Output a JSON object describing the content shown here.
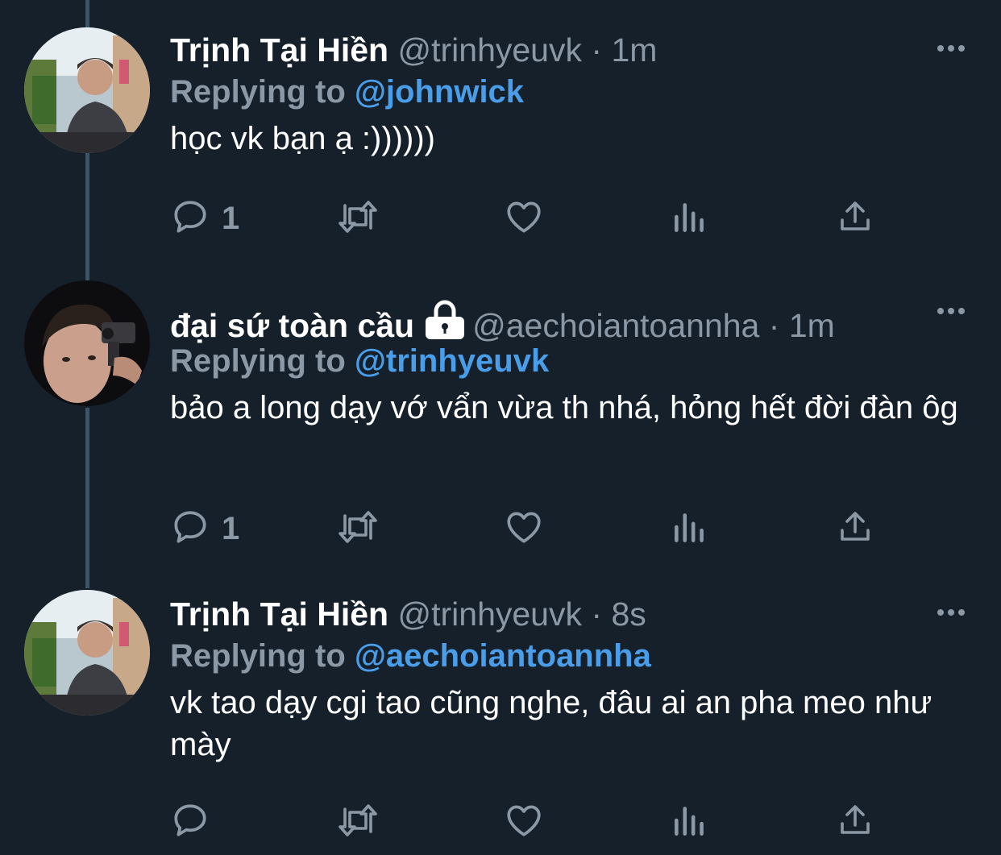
{
  "tweets": [
    {
      "name": "Trịnh Tại Hiền",
      "handle": "@trinhyeuvk",
      "dot": "·",
      "time": "1m",
      "reply_label": "Replying to",
      "reply_to": "@johnwick",
      "text": "học vk bạn ạ :))))))",
      "reply_count": "1",
      "locked": false
    },
    {
      "name": "đại sứ toàn cầu",
      "handle": "@aechoiantoannha",
      "dot": "·",
      "time": "1m",
      "reply_label": "Replying to",
      "reply_to": "@trinhyeuvk",
      "text": "bảo a long dạy vớ vẩn vừa th nhá, hỏng hết đời đàn ôg",
      "reply_count": "1",
      "locked": true
    },
    {
      "name": "Trịnh Tại Hiền",
      "handle": "@trinhyeuvk",
      "dot": "·",
      "time": "8s",
      "reply_label": "Replying to",
      "reply_to": "@aechoiantoannha",
      "text": "vk tao dạy cgi tao cũng nghe, đâu ai an pha meo như mày",
      "reply_count": "",
      "locked": false
    }
  ],
  "icons": {
    "reply": "speech-bubble-icon",
    "retweet": "retweet-icon",
    "like": "heart-icon",
    "analytics": "bar-chart-icon",
    "share": "share-icon",
    "more": "ellipsis-icon",
    "lock": "lock-icon"
  },
  "colors": {
    "background": "#15202b",
    "secondary_text": "#8b98a5",
    "link": "#4a9de8",
    "thread_line": "#3d5466"
  }
}
